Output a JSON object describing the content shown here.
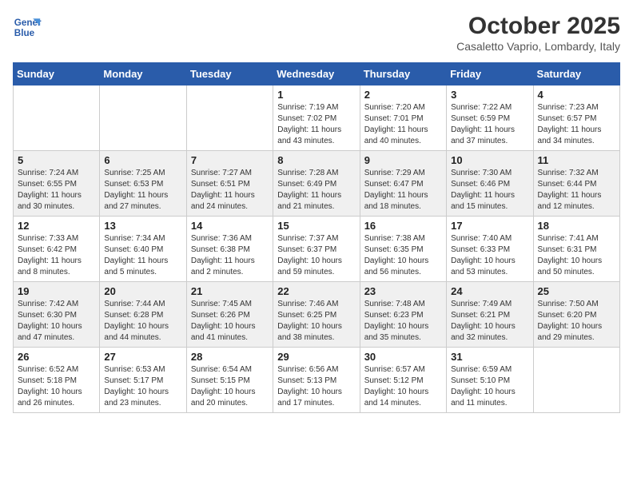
{
  "header": {
    "logo_line1": "General",
    "logo_line2": "Blue",
    "title": "October 2025",
    "subtitle": "Casaletto Vaprio, Lombardy, Italy"
  },
  "weekdays": [
    "Sunday",
    "Monday",
    "Tuesday",
    "Wednesday",
    "Thursday",
    "Friday",
    "Saturday"
  ],
  "weeks": [
    [
      {
        "day": "",
        "info": ""
      },
      {
        "day": "",
        "info": ""
      },
      {
        "day": "",
        "info": ""
      },
      {
        "day": "1",
        "info": "Sunrise: 7:19 AM\nSunset: 7:02 PM\nDaylight: 11 hours\nand 43 minutes."
      },
      {
        "day": "2",
        "info": "Sunrise: 7:20 AM\nSunset: 7:01 PM\nDaylight: 11 hours\nand 40 minutes."
      },
      {
        "day": "3",
        "info": "Sunrise: 7:22 AM\nSunset: 6:59 PM\nDaylight: 11 hours\nand 37 minutes."
      },
      {
        "day": "4",
        "info": "Sunrise: 7:23 AM\nSunset: 6:57 PM\nDaylight: 11 hours\nand 34 minutes."
      }
    ],
    [
      {
        "day": "5",
        "info": "Sunrise: 7:24 AM\nSunset: 6:55 PM\nDaylight: 11 hours\nand 30 minutes."
      },
      {
        "day": "6",
        "info": "Sunrise: 7:25 AM\nSunset: 6:53 PM\nDaylight: 11 hours\nand 27 minutes."
      },
      {
        "day": "7",
        "info": "Sunrise: 7:27 AM\nSunset: 6:51 PM\nDaylight: 11 hours\nand 24 minutes."
      },
      {
        "day": "8",
        "info": "Sunrise: 7:28 AM\nSunset: 6:49 PM\nDaylight: 11 hours\nand 21 minutes."
      },
      {
        "day": "9",
        "info": "Sunrise: 7:29 AM\nSunset: 6:47 PM\nDaylight: 11 hours\nand 18 minutes."
      },
      {
        "day": "10",
        "info": "Sunrise: 7:30 AM\nSunset: 6:46 PM\nDaylight: 11 hours\nand 15 minutes."
      },
      {
        "day": "11",
        "info": "Sunrise: 7:32 AM\nSunset: 6:44 PM\nDaylight: 11 hours\nand 12 minutes."
      }
    ],
    [
      {
        "day": "12",
        "info": "Sunrise: 7:33 AM\nSunset: 6:42 PM\nDaylight: 11 hours\nand 8 minutes."
      },
      {
        "day": "13",
        "info": "Sunrise: 7:34 AM\nSunset: 6:40 PM\nDaylight: 11 hours\nand 5 minutes."
      },
      {
        "day": "14",
        "info": "Sunrise: 7:36 AM\nSunset: 6:38 PM\nDaylight: 11 hours\nand 2 minutes."
      },
      {
        "day": "15",
        "info": "Sunrise: 7:37 AM\nSunset: 6:37 PM\nDaylight: 10 hours\nand 59 minutes."
      },
      {
        "day": "16",
        "info": "Sunrise: 7:38 AM\nSunset: 6:35 PM\nDaylight: 10 hours\nand 56 minutes."
      },
      {
        "day": "17",
        "info": "Sunrise: 7:40 AM\nSunset: 6:33 PM\nDaylight: 10 hours\nand 53 minutes."
      },
      {
        "day": "18",
        "info": "Sunrise: 7:41 AM\nSunset: 6:31 PM\nDaylight: 10 hours\nand 50 minutes."
      }
    ],
    [
      {
        "day": "19",
        "info": "Sunrise: 7:42 AM\nSunset: 6:30 PM\nDaylight: 10 hours\nand 47 minutes."
      },
      {
        "day": "20",
        "info": "Sunrise: 7:44 AM\nSunset: 6:28 PM\nDaylight: 10 hours\nand 44 minutes."
      },
      {
        "day": "21",
        "info": "Sunrise: 7:45 AM\nSunset: 6:26 PM\nDaylight: 10 hours\nand 41 minutes."
      },
      {
        "day": "22",
        "info": "Sunrise: 7:46 AM\nSunset: 6:25 PM\nDaylight: 10 hours\nand 38 minutes."
      },
      {
        "day": "23",
        "info": "Sunrise: 7:48 AM\nSunset: 6:23 PM\nDaylight: 10 hours\nand 35 minutes."
      },
      {
        "day": "24",
        "info": "Sunrise: 7:49 AM\nSunset: 6:21 PM\nDaylight: 10 hours\nand 32 minutes."
      },
      {
        "day": "25",
        "info": "Sunrise: 7:50 AM\nSunset: 6:20 PM\nDaylight: 10 hours\nand 29 minutes."
      }
    ],
    [
      {
        "day": "26",
        "info": "Sunrise: 6:52 AM\nSunset: 5:18 PM\nDaylight: 10 hours\nand 26 minutes."
      },
      {
        "day": "27",
        "info": "Sunrise: 6:53 AM\nSunset: 5:17 PM\nDaylight: 10 hours\nand 23 minutes."
      },
      {
        "day": "28",
        "info": "Sunrise: 6:54 AM\nSunset: 5:15 PM\nDaylight: 10 hours\nand 20 minutes."
      },
      {
        "day": "29",
        "info": "Sunrise: 6:56 AM\nSunset: 5:13 PM\nDaylight: 10 hours\nand 17 minutes."
      },
      {
        "day": "30",
        "info": "Sunrise: 6:57 AM\nSunset: 5:12 PM\nDaylight: 10 hours\nand 14 minutes."
      },
      {
        "day": "31",
        "info": "Sunrise: 6:59 AM\nSunset: 5:10 PM\nDaylight: 10 hours\nand 11 minutes."
      },
      {
        "day": "",
        "info": ""
      }
    ]
  ]
}
